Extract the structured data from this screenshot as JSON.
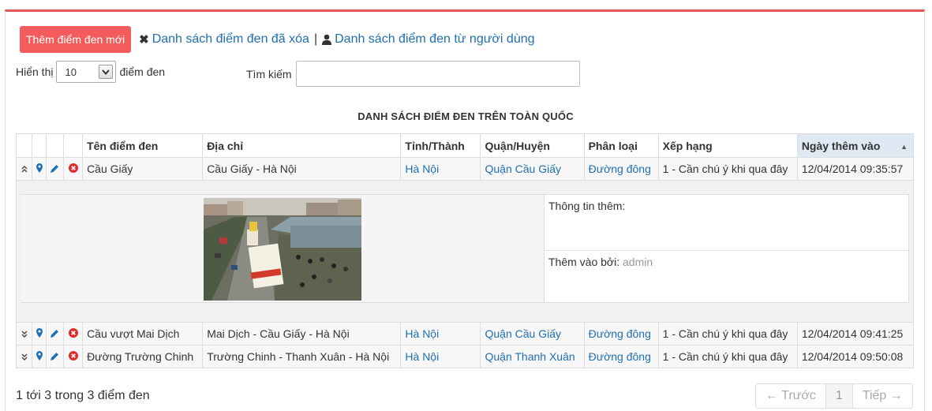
{
  "toolbar": {
    "add_label": "Thêm điểm đen mới",
    "deleted_link": "Danh sách điểm đen đã xóa",
    "separator": "|",
    "user_link": "Danh sách điểm đen từ người dùng"
  },
  "length_menu": {
    "prefix": "Hiển thị",
    "value": "10",
    "suffix": "điểm đen"
  },
  "search": {
    "label": "Tìm kiếm",
    "value": ""
  },
  "table": {
    "title": "DANH SÁCH ĐIỂM ĐEN TRÊN TOÀN QUỐC",
    "columns": [
      "Tên điểm đen",
      "Địa chỉ",
      "Tỉnh/Thành",
      "Quận/Huyện",
      "Phân loại",
      "Xếp hạng",
      "Ngày thêm vào"
    ],
    "rows": [
      {
        "name": "Cầu Giấy",
        "address": "Cầu Giấy - Hà Nội",
        "province": "Hà Nội",
        "district": "Quận Cầu Giấy",
        "type": "Đường đông",
        "rank": "1 - Cần chú ý khi qua đây",
        "date": "12/04/2014 09:35:57"
      },
      {
        "name": "Cầu vượt Mai Dịch",
        "address": "Mai Dịch - Cầu Giấy - Hà Nội",
        "province": "Hà Nội",
        "district": "Quận Cầu Giấy",
        "type": "Đường đông",
        "rank": "1 - Cần chú ý khi qua đây",
        "date": "12/04/2014 09:41:25"
      },
      {
        "name": "Đường Trường Chinh",
        "address": "Trường Chinh - Thanh Xuân - Hà Nội",
        "province": "Hà Nội",
        "district": "Quận Thanh Xuân",
        "type": "Đường đông",
        "rank": "1 - Cần chú ý khi qua đây",
        "date": "12/04/2014 09:50:08"
      }
    ],
    "detail": {
      "info_label": "Thông tin thêm:",
      "added_by_label": "Thêm vào bởi:",
      "added_by_value": "admin"
    }
  },
  "footer": {
    "info": "1 tới 3 trong 3 điểm đen",
    "prev": "← Trước",
    "page": "1",
    "next": "Tiếp →"
  },
  "colors": {
    "accent": "#f25c5c",
    "link": "#1f6fb2",
    "sorted_header": "#dfe9f3"
  }
}
